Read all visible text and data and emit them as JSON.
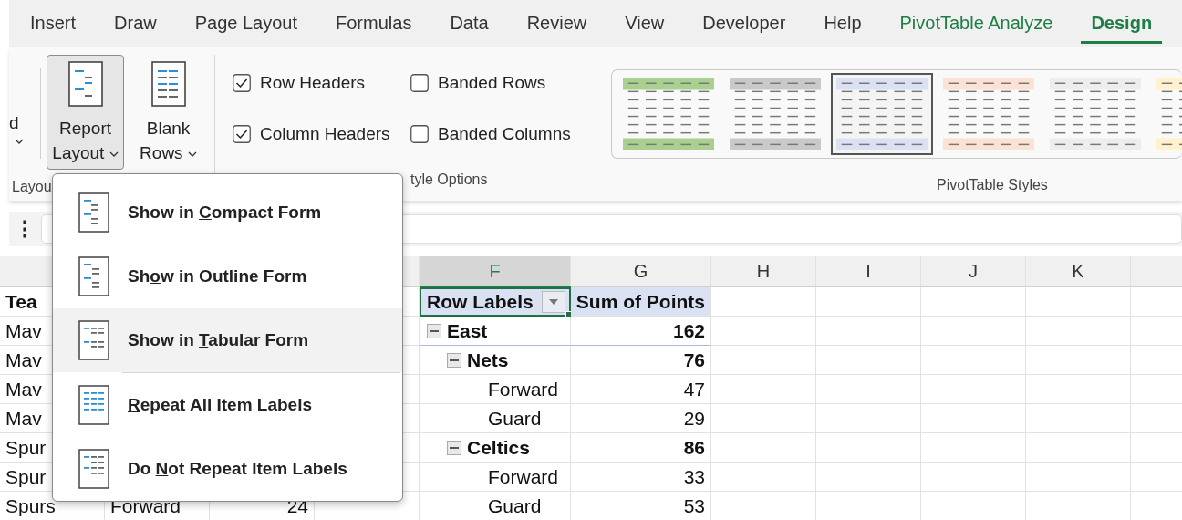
{
  "ribbon_tabs": [
    {
      "label": "Insert",
      "selected": false,
      "kind": "normal"
    },
    {
      "label": "Draw",
      "selected": false,
      "kind": "normal"
    },
    {
      "label": "Page Layout",
      "selected": false,
      "kind": "normal"
    },
    {
      "label": "Formulas",
      "selected": false,
      "kind": "normal"
    },
    {
      "label": "Data",
      "selected": false,
      "kind": "normal"
    },
    {
      "label": "Review",
      "selected": false,
      "kind": "normal"
    },
    {
      "label": "View",
      "selected": false,
      "kind": "normal"
    },
    {
      "label": "Developer",
      "selected": false,
      "kind": "normal"
    },
    {
      "label": "Help",
      "selected": false,
      "kind": "normal"
    },
    {
      "label": "PivotTable Analyze",
      "selected": false,
      "kind": "contextual"
    },
    {
      "label": "Design",
      "selected": true,
      "kind": "contextual"
    }
  ],
  "layout_group": {
    "partial_button_text": "d",
    "label": "Layou",
    "buttons": [
      {
        "lines": [
          "Report",
          "Layout"
        ],
        "pressed": true
      },
      {
        "lines": [
          "Blank",
          "Rows"
        ],
        "pressed": false
      }
    ]
  },
  "style_options": {
    "label": "tyle Options",
    "checkboxes": [
      {
        "label": "Row Headers",
        "checked": true
      },
      {
        "label": "Banded Rows",
        "checked": false
      },
      {
        "label": "Column Headers",
        "checked": true
      },
      {
        "label": "Banded Columns",
        "checked": false
      }
    ]
  },
  "styles": {
    "label": "PivotTable Styles",
    "swatches": [
      {
        "color": "#a9d08e",
        "selected": false
      },
      {
        "color": "#c9c9c9",
        "selected": false
      },
      {
        "color": "#d9e1f2",
        "selected": true
      },
      {
        "color": "#fbe2d5",
        "selected": false
      },
      {
        "color": "#ededed",
        "selected": false
      },
      {
        "color": "#fff2cc",
        "selected": false
      }
    ]
  },
  "formula_bar": {
    "menu_glyph": "⋮"
  },
  "sheet": {
    "columns": [
      {
        "label": "F",
        "selected": true
      },
      {
        "label": "G",
        "selected": false
      },
      {
        "label": "H",
        "selected": false
      },
      {
        "label": "I",
        "selected": false
      },
      {
        "label": "J",
        "selected": false
      },
      {
        "label": "K",
        "selected": false
      }
    ],
    "left_rows": [
      {
        "cells": [
          "Tea"
        ],
        "kind": "header"
      },
      {
        "cells": [
          "Mav"
        ],
        "kind": "data"
      },
      {
        "cells": [
          "Mav"
        ],
        "kind": "data"
      },
      {
        "cells": [
          "Mav"
        ],
        "kind": "data"
      },
      {
        "cells": [
          "Mav"
        ],
        "kind": "data"
      },
      {
        "cells": [
          "Spur"
        ],
        "kind": "data"
      },
      {
        "cells": [
          "Spur"
        ],
        "kind": "data"
      },
      {
        "cells": [
          "Spurs",
          "Forward",
          "24"
        ],
        "kind": "data"
      }
    ],
    "pivot": {
      "row_labels": "Row Labels",
      "values_label": "Sum of Points",
      "rows": [
        {
          "label": "East",
          "value": "162",
          "expanded": true,
          "children": [
            {
              "label": "Nets",
              "value": "76",
              "expanded": true,
              "children": [
                {
                  "label": "Forward",
                  "value": "47"
                },
                {
                  "label": "Guard",
                  "value": "29"
                }
              ]
            },
            {
              "label": "Celtics",
              "value": "86",
              "expanded": true,
              "children": [
                {
                  "label": "Forward",
                  "value": "33"
                },
                {
                  "label": "Guard",
                  "value": "53"
                }
              ]
            }
          ]
        }
      ]
    }
  },
  "report_layout_menu": [
    {
      "before": "Show in ",
      "key": "C",
      "after": "ompact Form",
      "selected": false,
      "separator_after": false
    },
    {
      "before": "Sh",
      "key": "o",
      "after": "w in Outline Form",
      "selected": false,
      "separator_after": false
    },
    {
      "before": "Show in ",
      "key": "T",
      "after": "abular Form",
      "selected": true,
      "separator_after": true
    },
    {
      "key": "R",
      "after": "epeat All Item Labels",
      "selected": false,
      "separator_after": false
    },
    {
      "before": "Do ",
      "key": "N",
      "after": "ot Repeat Item Labels",
      "selected": false,
      "separator_after": false
    }
  ]
}
